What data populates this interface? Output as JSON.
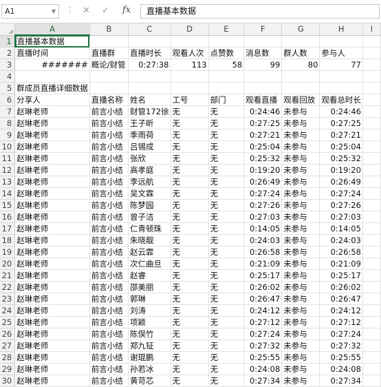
{
  "formula_bar": {
    "name_box": "A1",
    "cancel_icon": "close-icon",
    "confirm_icon": "check-icon",
    "fx_label": "fx",
    "content": "直播基本数据"
  },
  "sheet": {
    "columns": [
      "A",
      "B",
      "C",
      "D",
      "E",
      "F",
      "G",
      "H",
      "I"
    ],
    "active_column": "A",
    "active_row": 1,
    "rows": [
      [
        "直播基本数据",
        "",
        "",
        "",
        "",
        "",
        "",
        "",
        ""
      ],
      [
        "直播时间",
        "直播群",
        "直播时长",
        "观看人次",
        "点赞数",
        "消息数",
        "群人数",
        "参与人",
        ""
      ],
      [
        "#######",
        "概论/财管",
        "0:27:38",
        "113",
        "58",
        "99",
        "80",
        "77",
        ""
      ],
      [
        "",
        "",
        "",
        "",
        "",
        "",
        "",
        "",
        ""
      ],
      [
        "群成员直播详细数据",
        "",
        "",
        "",
        "",
        "",
        "",
        "",
        ""
      ],
      [
        "分享人",
        "直播名称",
        "姓名",
        "工号",
        "部门",
        "观看直播",
        "观看回放",
        "观看总时长",
        ""
      ],
      [
        "赵琳老师",
        "前言小结",
        "财管172徐",
        "无",
        "无",
        "0:24:46",
        "未参与",
        "0:24:46",
        ""
      ],
      [
        "赵琳老师",
        "前言小结",
        "王子昕",
        "无",
        "无",
        "0:27:25",
        "未参与",
        "0:27:25",
        ""
      ],
      [
        "赵琳老师",
        "前言小结",
        "季雨荷",
        "无",
        "无",
        "0:27:21",
        "未参与",
        "0:27:21",
        ""
      ],
      [
        "赵琳老师",
        "前言小结",
        "吕锡成",
        "无",
        "无",
        "0:25:04",
        "未参与",
        "0:25:04",
        ""
      ],
      [
        "赵琳老师",
        "前言小结",
        "张欣",
        "无",
        "无",
        "0:25:32",
        "未参与",
        "0:25:32",
        ""
      ],
      [
        "赵琳老师",
        "前言小结",
        "高孝庭",
        "无",
        "无",
        "0:19:20",
        "未参与",
        "0:19:20",
        ""
      ],
      [
        "赵琳老师",
        "前言小结",
        "李远航",
        "无",
        "无",
        "0:26:49",
        "未参与",
        "0:26:49",
        ""
      ],
      [
        "赵琳老师",
        "前言小结",
        "吴文霖",
        "无",
        "无",
        "0:27:24",
        "未参与",
        "0:27:24",
        ""
      ],
      [
        "赵琳老师",
        "前言小结",
        "陈梦园",
        "无",
        "无",
        "0:27:26",
        "未参与",
        "0:27:26",
        ""
      ],
      [
        "赵琳老师",
        "前言小结",
        "曾子洁",
        "无",
        "无",
        "0:27:03",
        "未参与",
        "0:27:03",
        ""
      ],
      [
        "赵琳老师",
        "前言小结",
        "仁青顿珠",
        "无",
        "无",
        "0:14:05",
        "未参与",
        "0:14:05",
        ""
      ],
      [
        "赵琳老师",
        "前言小结",
        "朱晓靓",
        "无",
        "无",
        "0:24:03",
        "未参与",
        "0:24:03",
        ""
      ],
      [
        "赵琳老师",
        "前言小结",
        "赵云霏",
        "无",
        "无",
        "0:26:58",
        "未参与",
        "0:26:58",
        ""
      ],
      [
        "赵琳老师",
        "前言小结",
        "次仁曲旦",
        "无",
        "无",
        "0:21:09",
        "未参与",
        "0:21:09",
        ""
      ],
      [
        "赵琳老师",
        "前言小结",
        "赵睿",
        "无",
        "无",
        "0:25:17",
        "未参与",
        "0:25:17",
        ""
      ],
      [
        "赵琳老师",
        "前言小结",
        "邵美丽",
        "无",
        "无",
        "0:26:02",
        "未参与",
        "0:26:02",
        ""
      ],
      [
        "赵琳老师",
        "前言小结",
        "郭琳",
        "无",
        "无",
        "0:26:47",
        "未参与",
        "0:26:47",
        ""
      ],
      [
        "赵琳老师",
        "前言小结",
        "刘涛",
        "无",
        "无",
        "0:24:12",
        "未参与",
        "0:24:12",
        ""
      ],
      [
        "赵琳老师",
        "前言小结",
        "项颖",
        "无",
        "无",
        "0:27:12",
        "未参与",
        "0:27:12",
        ""
      ],
      [
        "赵琳老师",
        "前言小结",
        "陈俣竹",
        "无",
        "无",
        "0:27:24",
        "未参与",
        "0:27:24",
        ""
      ],
      [
        "赵琳老师",
        "前言小结",
        "郑九钲",
        "无",
        "无",
        "0:27:32",
        "未参与",
        "0:27:32",
        ""
      ],
      [
        "赵琳老师",
        "前言小结",
        "谢琨鹏",
        "无",
        "无",
        "0:25:55",
        "未参与",
        "0:25:55",
        ""
      ],
      [
        "赵琳老师",
        "前言小结",
        "孙若冰",
        "无",
        "无",
        "0:24:08",
        "未参与",
        "0:24:08",
        ""
      ],
      [
        "赵琳老师",
        "前言小结",
        "黄苛芯",
        "无",
        "无",
        "0:27:34",
        "未参与",
        "0:27:34",
        ""
      ]
    ]
  },
  "colors": {
    "accent": "#217346",
    "header_bg": "#f2f2f2",
    "gridline": "#e1e1e1"
  }
}
